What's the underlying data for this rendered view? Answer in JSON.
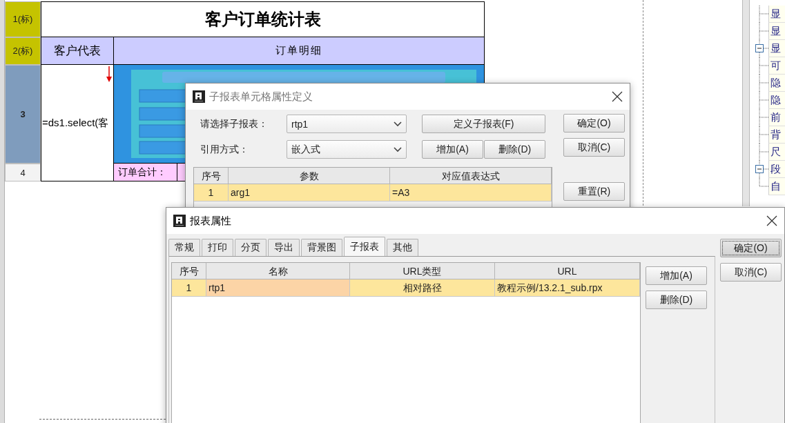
{
  "sheet": {
    "row_headers": [
      {
        "label": "1(标)",
        "kind": "title",
        "selected": false
      },
      {
        "label": "2(标)",
        "kind": "title",
        "selected": false
      },
      {
        "label": "3",
        "kind": "detail",
        "selected": true
      },
      {
        "label": "4",
        "kind": "detail",
        "selected": false
      }
    ],
    "title": "客户订单统计表",
    "column_a_header": "客户代表",
    "column_b_header": "订单明细",
    "formula": "=ds1.select(客",
    "total_label": "订单合计："
  },
  "property_tree": {
    "items": [
      {
        "label": "显",
        "kind": "leaf"
      },
      {
        "label": "显",
        "kind": "leaf"
      },
      {
        "label": "显",
        "kind": "group",
        "expanded": true,
        "children": [
          {
            "label": "可",
            "kind": "leaf"
          },
          {
            "label": "隐",
            "kind": "leaf"
          },
          {
            "label": "隐",
            "kind": "leaf"
          },
          {
            "label": "前",
            "kind": "leaf"
          },
          {
            "label": "背",
            "kind": "leaf"
          },
          {
            "label": "尺",
            "kind": "leaf"
          }
        ]
      },
      {
        "label": "段",
        "kind": "group",
        "expanded": true,
        "children": [
          {
            "label": "自",
            "kind": "leaf"
          }
        ]
      }
    ]
  },
  "subreport_cell_dialog": {
    "title": "子报表单元格属性定义",
    "fields": [
      {
        "label": "请选择子报表：",
        "value": "rtp1"
      },
      {
        "label": "引用方式：",
        "value": "嵌入式"
      }
    ],
    "define_button": "定义子报表(F)",
    "row_buttons": [
      "增加(A)",
      "删除(D)"
    ],
    "buttons": [
      "确定(O)",
      "取消(C)",
      "重置(R)"
    ],
    "table": {
      "columns": [
        "序号",
        "参数",
        "对应值表达式"
      ],
      "rows": [
        {
          "cells": [
            "1",
            "arg1",
            "=A3"
          ],
          "selected": true
        }
      ]
    }
  },
  "report_properties_dialog": {
    "title": "报表属性",
    "tabs": [
      {
        "label": "常规",
        "selected": false
      },
      {
        "label": "打印",
        "selected": false
      },
      {
        "label": "分页",
        "selected": false
      },
      {
        "label": "导出",
        "selected": false
      },
      {
        "label": "背景图",
        "selected": false
      },
      {
        "label": "子报表",
        "selected": true
      },
      {
        "label": "其他",
        "selected": false
      }
    ],
    "table": {
      "columns": [
        "序号",
        "名称",
        "URL类型",
        "URL"
      ],
      "rows": [
        {
          "cells": [
            {
              "text": "1",
              "focused": false
            },
            {
              "text": "rtp1",
              "focused": true
            },
            {
              "text": "相对路径",
              "focused": false
            },
            {
              "text": "教程示例/13.2.1_sub.rpx",
              "focused": false
            }
          ],
          "selected": true
        }
      ]
    },
    "row_buttons": [
      "增加(A)",
      "删除(D)"
    ],
    "buttons": [
      {
        "label": "确定(O)",
        "focused": true
      },
      {
        "label": "取消(C)",
        "focused": false
      }
    ]
  }
}
